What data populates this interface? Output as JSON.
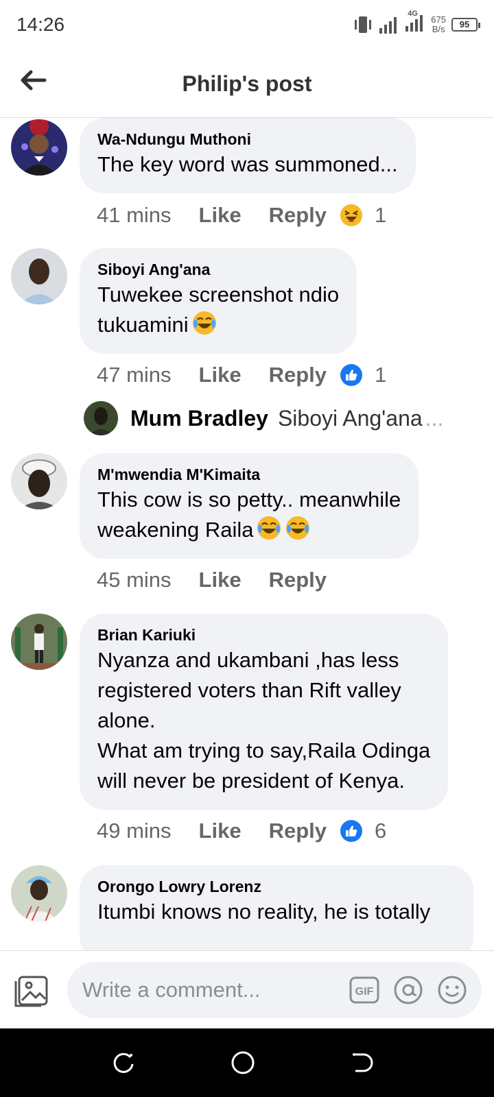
{
  "status_bar": {
    "time": "14:26",
    "network": "4G",
    "speed_value": "675",
    "speed_unit": "B/s",
    "battery": "95"
  },
  "header": {
    "title": "Philip's post"
  },
  "comments": [
    {
      "author": "Wa-Ndungu Muthoni",
      "text": "The  key word was summoned...",
      "time": "41 mins",
      "like_label": "Like",
      "reply_label": "Reply",
      "reaction_icon": "laughing-squint-emoji-icon",
      "reaction_count": "1"
    },
    {
      "author": "Siboyi Ang'ana",
      "text": "Tuwekee screenshot ndio\ntukuamini",
      "time": "47 mins",
      "like_label": "Like",
      "reply_label": "Reply",
      "reaction_icon": "like-thumbs-up-icon",
      "reaction_count": "1"
    },
    {
      "author": "M'mwendia M'Kimaita",
      "text": "This cow is so petty.. meanwhile\nweakening Raila",
      "time": "45 mins",
      "like_label": "Like",
      "reply_label": "Reply"
    },
    {
      "author": "Brian Kariuki",
      "text": "Nyanza and ukambani ,has less\nregistered voters than Rift valley\nalone.\nWhat am trying to say,Raila Odinga\nwill never be president of Kenya.",
      "time": "49 mins",
      "like_label": "Like",
      "reply_label": "Reply",
      "reaction_icon": "like-thumbs-up-icon",
      "reaction_count": "6"
    },
    {
      "author": "Orongo Lowry Lorenz",
      "text": "Itumbi knows no reality, he is totally"
    }
  ],
  "reply_preview": {
    "author": "Mum Bradley",
    "text": "Siboyi Ang'ana",
    "more": "..."
  },
  "composer": {
    "placeholder": "Write a comment...",
    "gif_label": "GIF"
  },
  "colors": {
    "bubble": "#f0f2f5",
    "meta_text": "#65676b",
    "like_blue": "#1877f2",
    "emoji_yellow": "#f7b928"
  }
}
